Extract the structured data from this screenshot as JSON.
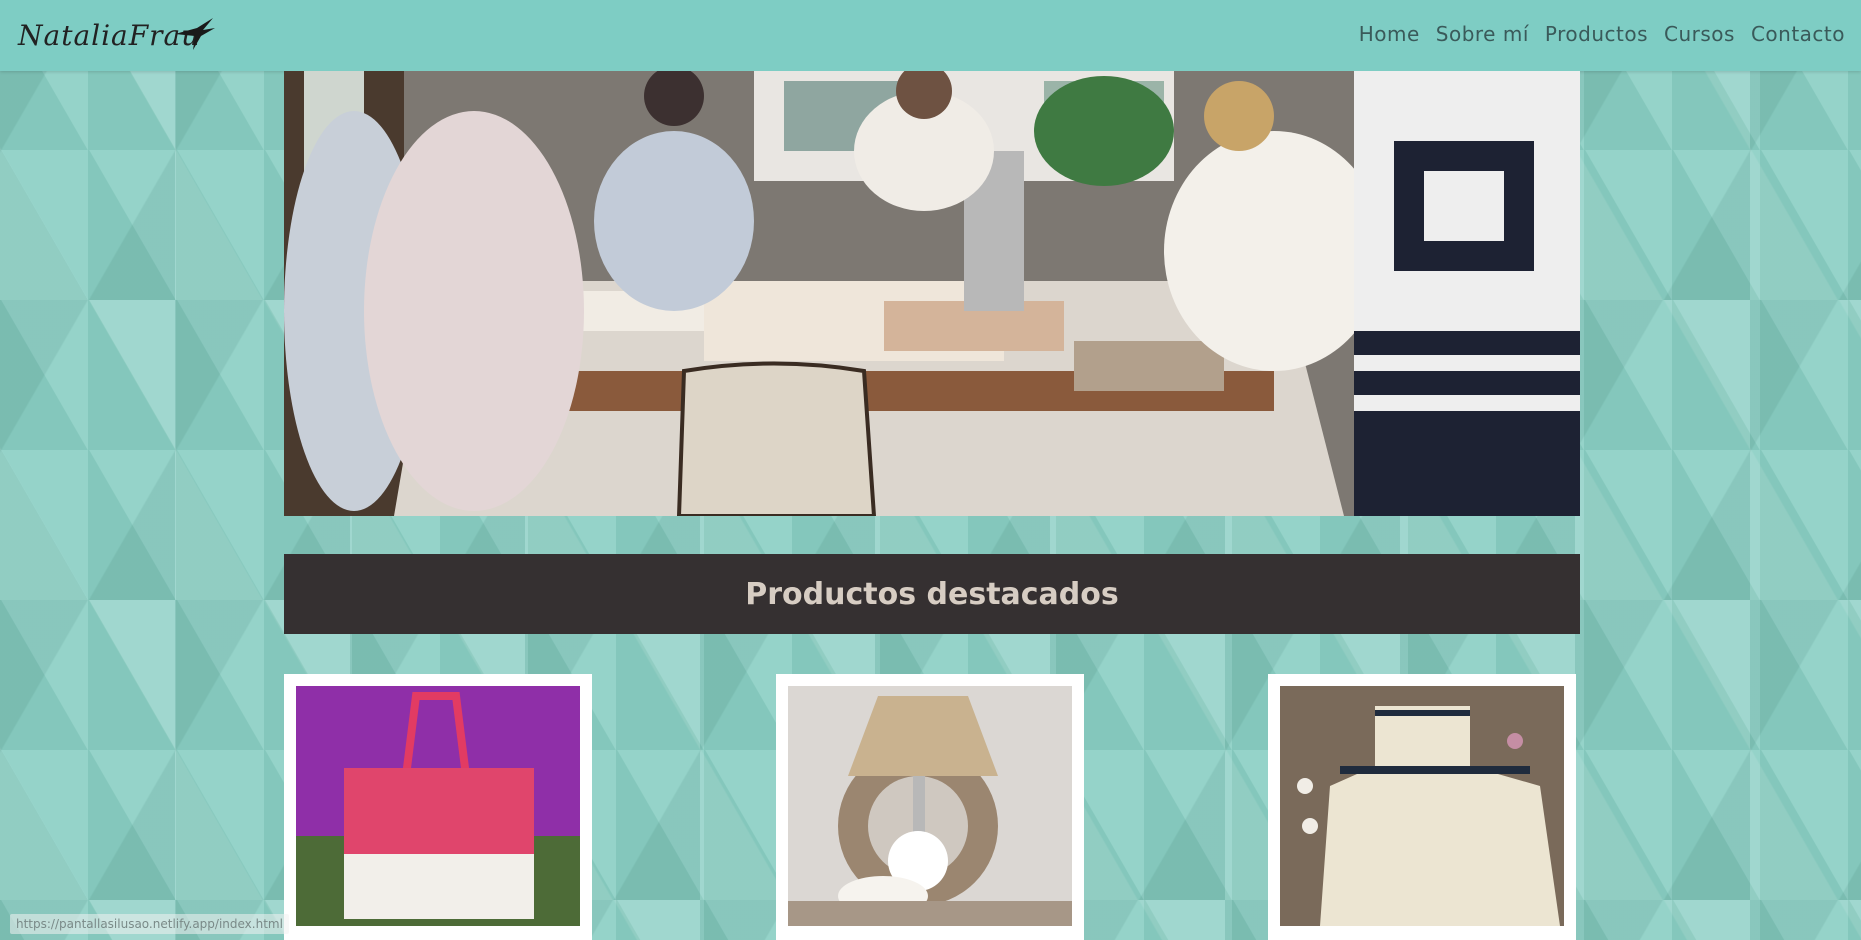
{
  "brand": {
    "logo_text": "NataliaFrau"
  },
  "nav": {
    "items": [
      {
        "label": "Home"
      },
      {
        "label": "Sobre mí"
      },
      {
        "label": "Productos"
      },
      {
        "label": "Cursos"
      },
      {
        "label": "Contacto"
      }
    ]
  },
  "section": {
    "title": "Productos destacados"
  },
  "status_bar": {
    "url": "https://pantallasilusao.netlify.app/index.html"
  },
  "colors": {
    "navbar": "#7ecdc4",
    "background": "#8ccfc4",
    "title_bar": "#353031",
    "title_text": "#d7cdc3",
    "nav_text": "#3a5a5a"
  }
}
